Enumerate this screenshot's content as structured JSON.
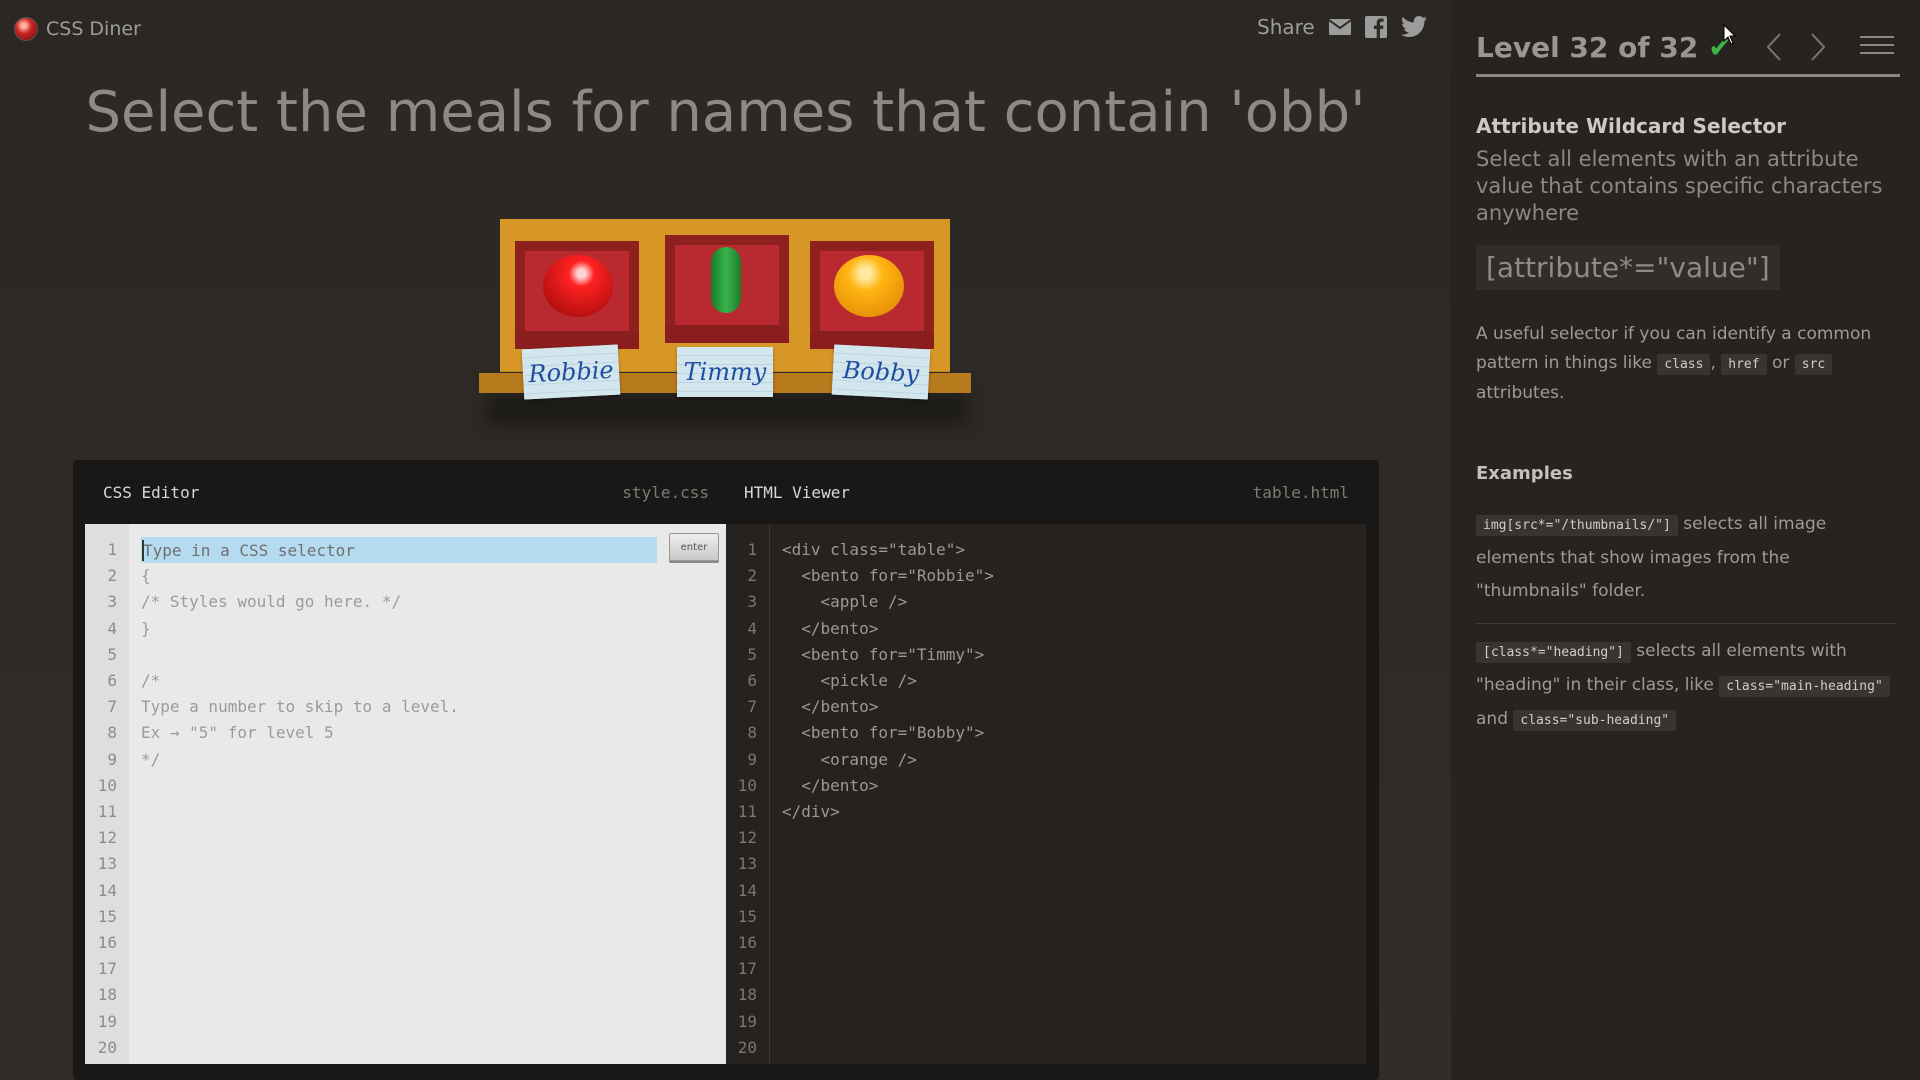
{
  "app": {
    "title": "CSS Diner",
    "share_label": "Share"
  },
  "instruction": "Select the meals for names that contain 'obb'",
  "table": {
    "bentos": [
      {
        "name": "Robbie",
        "item": "apple"
      },
      {
        "name": "Timmy",
        "item": "pickle"
      },
      {
        "name": "Bobby",
        "item": "orange"
      }
    ]
  },
  "editor": {
    "css_title": "CSS Editor",
    "css_file": "style.css",
    "html_title": "HTML Viewer",
    "html_file": "table.html",
    "input_placeholder": "Type in a CSS selector",
    "enter_label": "enter",
    "css_lines": [
      "{",
      "/* Styles would go here. */",
      "}",
      "",
      "/*",
      "Type a number to skip to a level.",
      "Ex → \"5\" for level 5",
      "*/"
    ],
    "html_lines": [
      "<div class=\"table\">",
      "  <bento for=\"Robbie\">",
      "    <apple />",
      "  </bento>",
      "  <bento for=\"Timmy\">",
      "    <pickle />",
      "  </bento>",
      "  <bento for=\"Bobby\">",
      "    <orange />",
      "  </bento>",
      "</div>"
    ],
    "line_count": 20
  },
  "sidebar": {
    "level_text": "Level 32 of 32",
    "completed": true,
    "progress": 1.0,
    "selector_name": "Attribute Wildcard Selector",
    "selector_desc": "Select all elements with an attribute value that contains specific characters anywhere",
    "syntax": "[attribute*=\"value\"]",
    "help_pre": "A useful selector if you can identify a common pattern in things like ",
    "help_chips": [
      "class",
      "href",
      "src"
    ],
    "help_sep1": ", ",
    "help_or": " or ",
    "help_post": " attributes.",
    "examples_title": "Examples",
    "example1_code": "img[src*=\"/thumbnails/\"]",
    "example1_text": " selects all image elements that show images from the \"thumbnails\" folder.",
    "example2_code": "[class*=\"heading\"]",
    "example2_text": " selects all elements with \"heading\" in their class, like ",
    "example2_code2": "class=\"main-heading\"",
    "example2_and": " and ",
    "example2_code3": "class=\"sub-heading\""
  },
  "colors": {
    "check": "#42b341",
    "background": "#2e2a25",
    "sidebar": "#262320"
  }
}
